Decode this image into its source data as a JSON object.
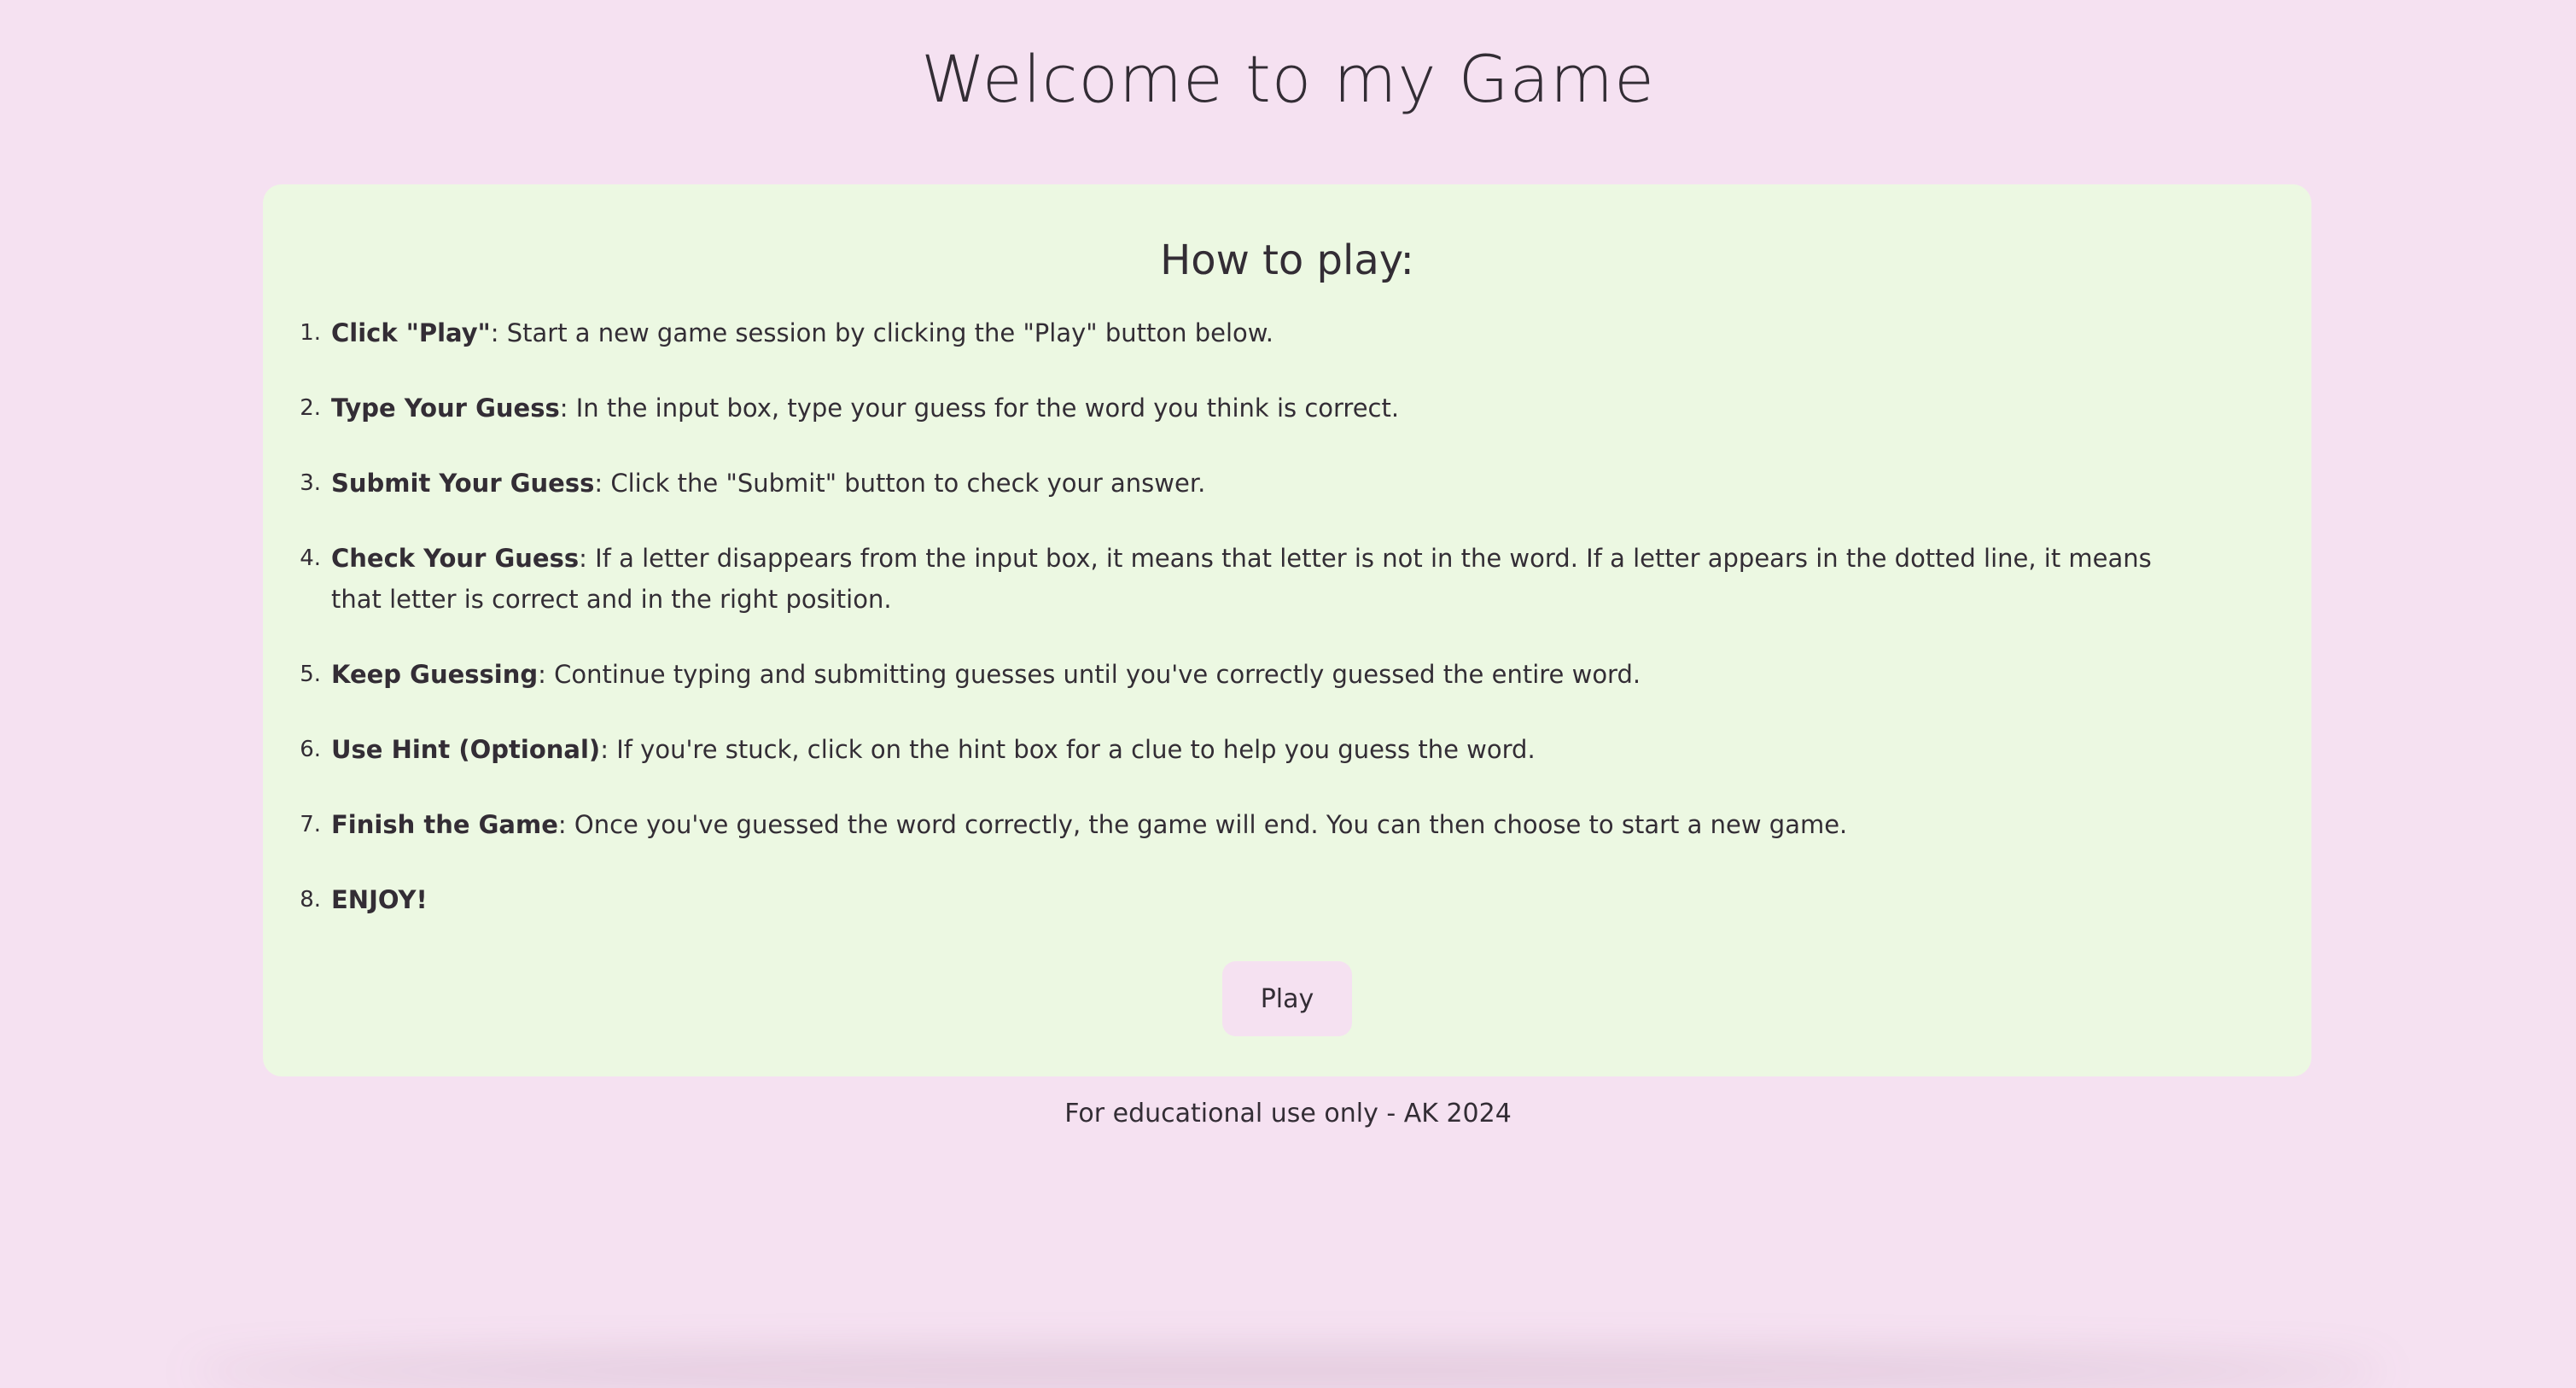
{
  "header": {
    "title": "Welcome to my Game"
  },
  "card": {
    "heading": "How to play:",
    "steps": [
      {
        "number": "1.",
        "title": "Click \"Play\"",
        "text": ": Start a new game session by clicking the \"Play\" button below."
      },
      {
        "number": "2.",
        "title": "Type Your Guess",
        "text": ": In the input box, type your guess for the word you think is correct."
      },
      {
        "number": "3.",
        "title": "Submit Your Guess",
        "text": ": Click the \"Submit\" button to check your answer."
      },
      {
        "number": "4.",
        "title": "Check Your Guess",
        "text": ": If a letter disappears from the input box, it means that letter is not in the word. If a letter appears in the dotted line, it means that letter is correct and in the right position."
      },
      {
        "number": "5.",
        "title": "Keep Guessing",
        "text": ": Continue typing and submitting guesses until you've correctly guessed the entire word."
      },
      {
        "number": "6.",
        "title": "Use Hint (Optional)",
        "text": ": If you're stuck, click on the hint box for a clue to help you guess the word."
      },
      {
        "number": "7.",
        "title": "Finish the Game",
        "text": ": Once you've guessed the word correctly, the game will end. You can then choose to start a new game."
      },
      {
        "number": "8.",
        "title": "",
        "text": "ENJOY!"
      }
    ],
    "play_label": "Play"
  },
  "footer": {
    "text": "For educational use only - AK 2024"
  },
  "colors": {
    "background": "#f5e1f1",
    "card": "#ecf8e2",
    "text": "#332d35"
  }
}
